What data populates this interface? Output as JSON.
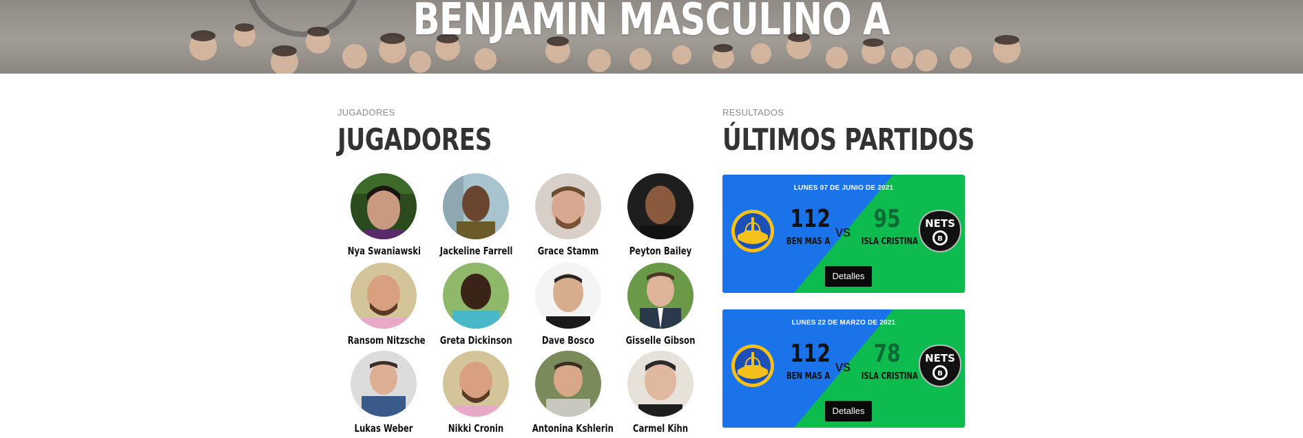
{
  "hero": {
    "title": "BENJAMÍN MASCULINO A"
  },
  "players_section": {
    "eyebrow": "JUGADORES",
    "title": "JUGADORES",
    "players": [
      {
        "name": "Nya Swaniawski"
      },
      {
        "name": "Jackeline Farrell"
      },
      {
        "name": "Grace Stamm"
      },
      {
        "name": "Peyton Bailey"
      },
      {
        "name": "Ransom Nitzsche"
      },
      {
        "name": "Greta Dickinson"
      },
      {
        "name": "Dave Bosco"
      },
      {
        "name": "Gisselle Gibson"
      },
      {
        "name": "Lukas Weber"
      },
      {
        "name": "Nikki Cronin"
      },
      {
        "name": "Antonina Kshlerin"
      },
      {
        "name": "Carmel Kihn"
      }
    ]
  },
  "results_section": {
    "eyebrow": "RESULTADOS",
    "title": "ÚLTIMOS PARTIDOS",
    "matches": [
      {
        "date": "LUNES 07 DE JUNIO DE 2021",
        "home_score": "112",
        "home_team": "BEN MAS A",
        "vs": "vs",
        "away_score": "95",
        "away_team": "ISLA CRISTINA",
        "details_label": "Detalles"
      },
      {
        "date": "LUNES 22 DE MARZO DE 2021",
        "home_score": "112",
        "home_team": "BEN MAS A",
        "vs": "vs",
        "away_score": "78",
        "away_team": "ISLA CRISTINA",
        "details_label": "Detalles"
      }
    ]
  },
  "colors": {
    "home_panel": "#1a73e8",
    "away_panel": "#0dbb4f",
    "away_score_text": "#0b6b34",
    "button": "#0a0a0a"
  },
  "icons": {
    "home_logo": "warriors-logo-icon",
    "away_logo": "nets-logo-icon"
  }
}
